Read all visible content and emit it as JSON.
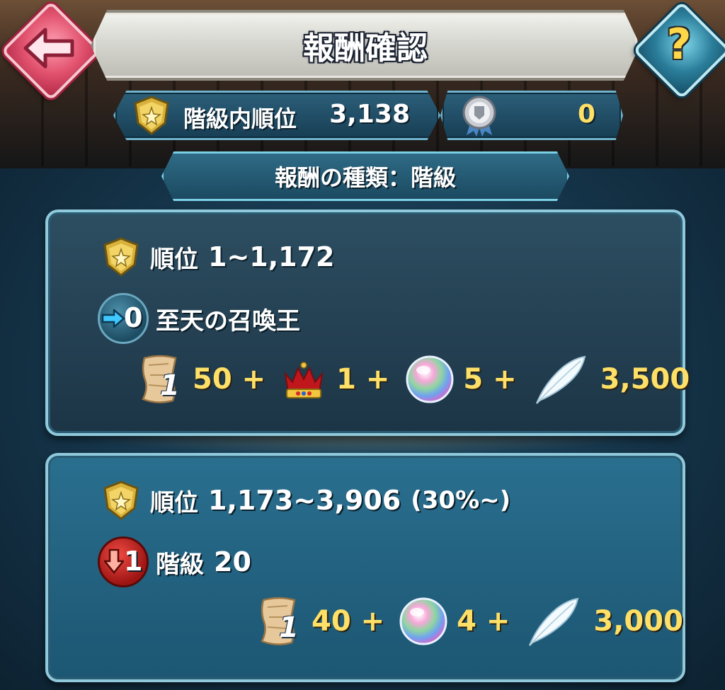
{
  "header": {
    "title": "報酬確認"
  },
  "stats": {
    "rank_label": "階級内順位",
    "rank_value": "3,138",
    "badge_value": "0"
  },
  "reward_type": {
    "label": "報酬の種類：階級"
  },
  "panels": [
    {
      "rank_prefix": "順位",
      "rank_range": "1~1,172",
      "tier_change": "0",
      "tier_text": "至天の召喚王",
      "rewards": [
        {
          "icon": "scroll-icon",
          "badge": "1",
          "amount": "50 +"
        },
        {
          "icon": "crown-icon",
          "amount": "1 +"
        },
        {
          "icon": "orb-icon",
          "amount": "5 +"
        },
        {
          "icon": "feather-icon",
          "amount": "3,500"
        }
      ]
    },
    {
      "rank_prefix": "順位",
      "rank_range": "1,173~3,906",
      "rank_extra": "(30%~)",
      "tier_change": "1",
      "tier_label": "階級",
      "tier_value": "20",
      "rewards": [
        {
          "icon": "scroll-icon",
          "badge": "1",
          "amount": "40 +"
        },
        {
          "icon": "orb-icon",
          "amount": "4 +"
        },
        {
          "icon": "feather-icon",
          "amount": "3,000"
        }
      ]
    }
  ],
  "colors": {
    "gold_text": "#ffe067",
    "panel_border": "#8fc9db",
    "back_button": "#e2536f",
    "help_button": "#2a7d9a"
  }
}
